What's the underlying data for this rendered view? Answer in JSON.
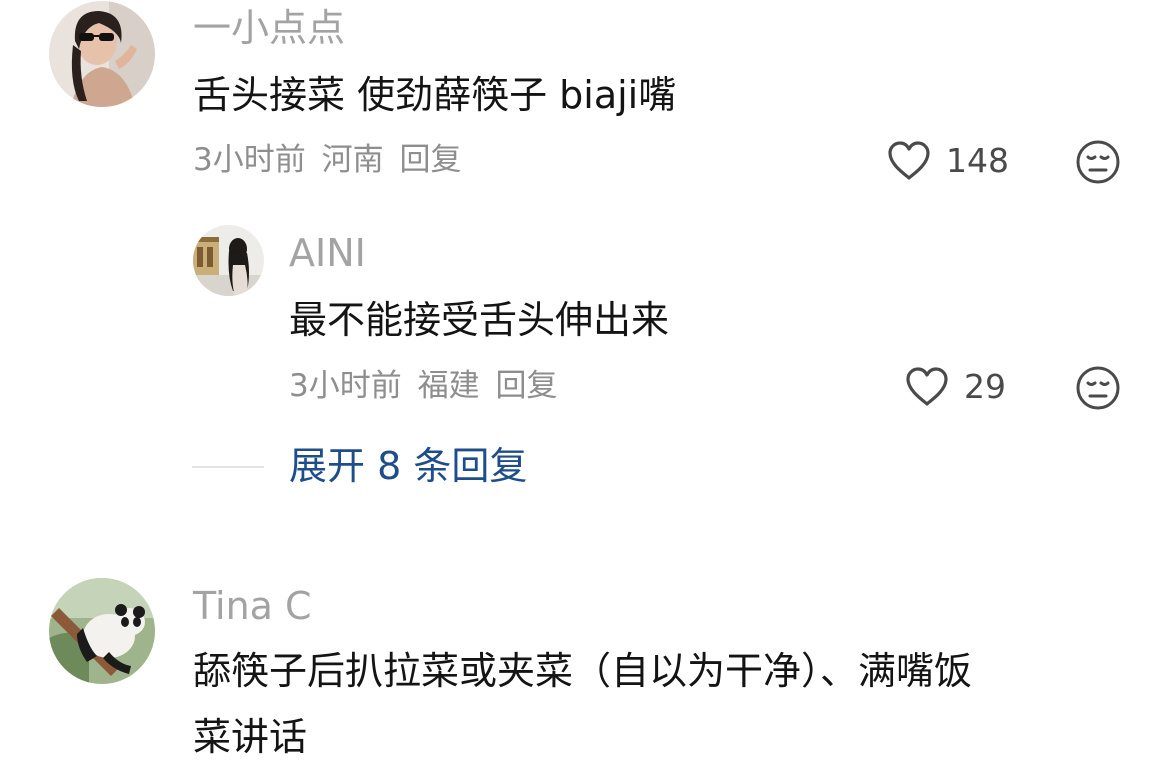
{
  "comments": [
    {
      "username": "一小点点",
      "text": "舌头接菜 使劲薛筷子 biaji嘴",
      "time": "3小时前",
      "location": "河南",
      "reply_label": "回复",
      "likes": "148",
      "replies": [
        {
          "username": "AINI",
          "text": "最不能接受舌头伸出来",
          "time": "3小时前",
          "location": "福建",
          "reply_label": "回复",
          "likes": "29"
        }
      ],
      "expand_label": "展开 8 条回复"
    },
    {
      "username": "Tina C",
      "text_line1": "舔筷子后扒拉菜或夹菜（自以为干净）、满嘴饭",
      "text_line2": "菜讲话"
    }
  ],
  "icons": {
    "like": "heart-outline-icon",
    "dislike": "neutral-face-icon"
  },
  "colors": {
    "username": "#a3a3a3",
    "body_text": "#141414",
    "meta": "#8e8e8e",
    "link": "#1e4d8c"
  }
}
